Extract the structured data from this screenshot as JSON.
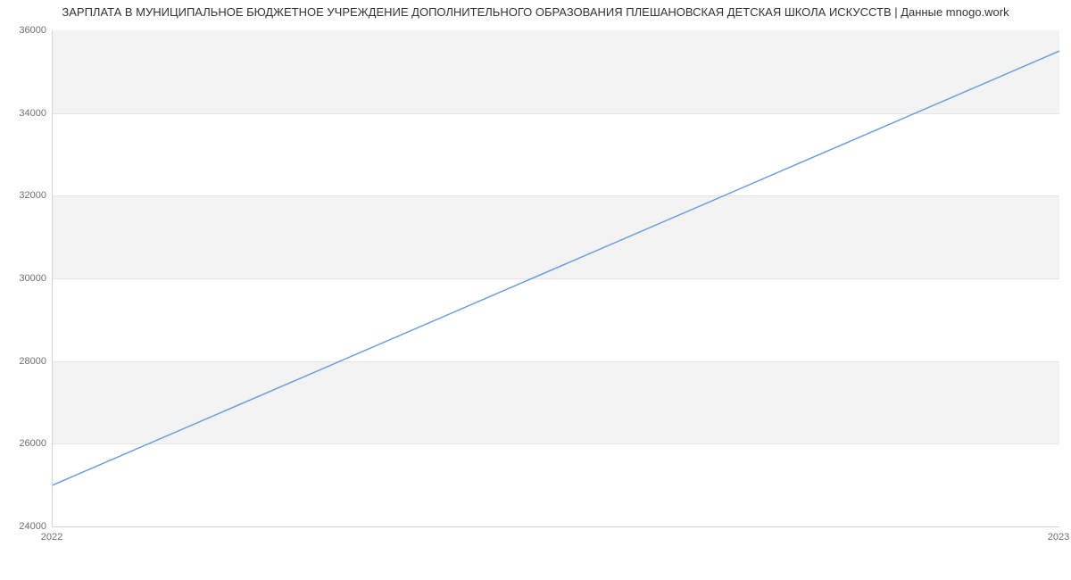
{
  "chart_data": {
    "type": "line",
    "title": "ЗАРПЛАТА В МУНИЦИПАЛЬНОЕ БЮДЖЕТНОЕ УЧРЕЖДЕНИЕ ДОПОЛНИТЕЛЬНОГО ОБРАЗОВАНИЯ ПЛЕШАНОВСКАЯ ДЕТСКАЯ ШКОЛА ИСКУССТВ | Данные mnogo.work",
    "x": [
      2022,
      2023
    ],
    "values": [
      25000,
      35500
    ],
    "xlabel": "",
    "ylabel": "",
    "xlim": [
      2022,
      2023
    ],
    "ylim": [
      24000,
      36000
    ],
    "xticks": [
      2022,
      2023
    ],
    "yticks": [
      24000,
      26000,
      28000,
      30000,
      32000,
      34000,
      36000
    ],
    "grid": true,
    "colors": {
      "line": "#6699dd",
      "band": "#f3f3f3"
    }
  },
  "ticks": {
    "y0": "24000",
    "y1": "26000",
    "y2": "28000",
    "y3": "30000",
    "y4": "32000",
    "y5": "34000",
    "y6": "36000",
    "x0": "2022",
    "x1": "2023"
  }
}
